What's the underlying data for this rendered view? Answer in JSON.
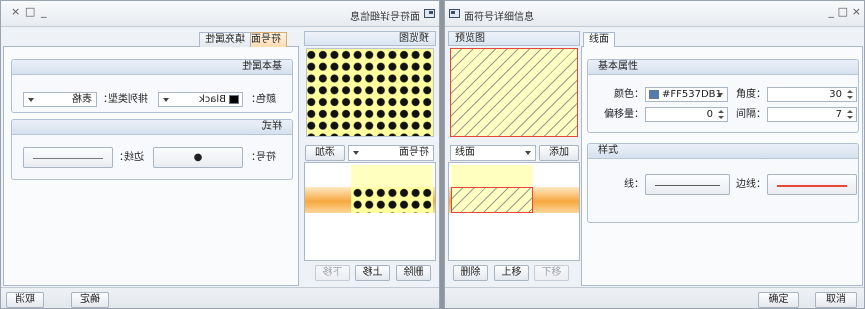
{
  "dialogs": [
    {
      "title": "面符号详细信息",
      "controls": {
        "minimize": "_",
        "maximize": "□",
        "close": "×"
      },
      "preview_header": "预览图",
      "fill_type": "符号面",
      "add_label": "添加",
      "list_buttons": {
        "delete": "删除",
        "move_up": "上移",
        "move_down": "下移"
      },
      "tabs": [
        "符号面",
        "填充属性"
      ],
      "basic": {
        "header": "基本属性",
        "color_label": "颜色：",
        "color_value": "Black",
        "color_swatch": "#000000",
        "arrange_label": "排列类型：",
        "arrange_value": "表格"
      },
      "style": {
        "header": "样式",
        "symbol_label": "符号：",
        "symbol_glyph": "●",
        "border_label": "边线：",
        "border_color": "#7A7A7A"
      },
      "footer": {
        "ok": "确定",
        "cancel": "取消"
      }
    },
    {
      "title": "面符号详细信息",
      "controls": {
        "minimize": "_",
        "maximize": "□",
        "close": "×"
      },
      "preview_header": "预览图",
      "fill_type": "线面",
      "add_label": "添加",
      "list_buttons": {
        "delete": "删除",
        "move_up": "上移",
        "move_down": "下移"
      },
      "tabs": [
        "线面"
      ],
      "basic": {
        "header": "基本属性",
        "color_label": "颜色：",
        "color_value": "#FF537DB1",
        "color_swatch": "#537DB1",
        "angle_label": "角度：",
        "angle_value": "30",
        "offset_label": "偏移量：",
        "offset_value": "0",
        "interval_label": "间隔：",
        "interval_value": "7"
      },
      "style": {
        "header": "样式",
        "line_label": "线：",
        "line_color": "#5A5A5A",
        "border_label": "边线：",
        "border_color": "#E8443A"
      },
      "footer": {
        "ok": "确定",
        "cancel": "取消"
      }
    }
  ]
}
